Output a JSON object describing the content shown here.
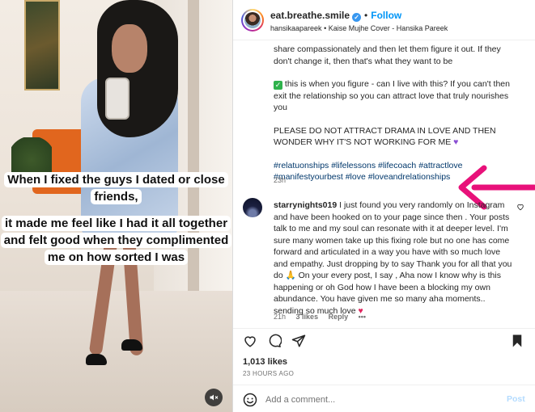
{
  "media": {
    "caption_line1": "When I fixed the guys I dated or close friends,",
    "caption_line2": "it made me feel like I had it all together and felt good when they complimented me on how sorted I was",
    "mute_icon": "speaker-muted-icon"
  },
  "header": {
    "username": "eat.breathe.smile",
    "separator": "•",
    "follow_label": "Follow",
    "audio_artist": "hansikaapareek",
    "audio_track": "Kaise Mujhe Cover - Hansika Pareek"
  },
  "caption": {
    "para1": "share compassionately and then let them figure it out. If they don't change it, then that's what they want to be",
    "para2": "this is when you figure - can I live with this? If you can't then exit the relationship so you can attract love that truly nourishes you",
    "para3": "PLEASE DO NOT ATTRACT DRAMA IN LOVE AND THEN WONDER WHY IT'S NOT WORKING FOR ME",
    "hashtags": "#relatuonships #lifelessons #lifecoach #attractlove #manifestyourbest #love #loveandrelationships",
    "time": "23h"
  },
  "comment": {
    "username": "starrynights019",
    "text": "I just found you very randomly on Instagram and have been hooked on to your page since then . Your posts talk to me and my soul can resonate with it at deeper level. I'm sure many women take up this fixing role but no one has come forward and articulated in a way you have with so much love and empathy. Just dropping by to say Thank you for all that you do 🙏 On your every post, I say , Aha now I know why is this happening or oh God how I have been a blocking my own abundance. You have given me so many aha moments.. sending so much love",
    "time": "21h",
    "likes": "3 likes",
    "reply": "Reply",
    "more": "•••"
  },
  "actions": {
    "likes_count": "1,013 likes",
    "posted_ago": "23 HOURS AGO"
  },
  "composer": {
    "placeholder": "Add a comment...",
    "post_label": "Post"
  },
  "colors": {
    "accent": "#0095f6",
    "arrow": "#e8117a",
    "post_disabled": "#b3dbff"
  }
}
